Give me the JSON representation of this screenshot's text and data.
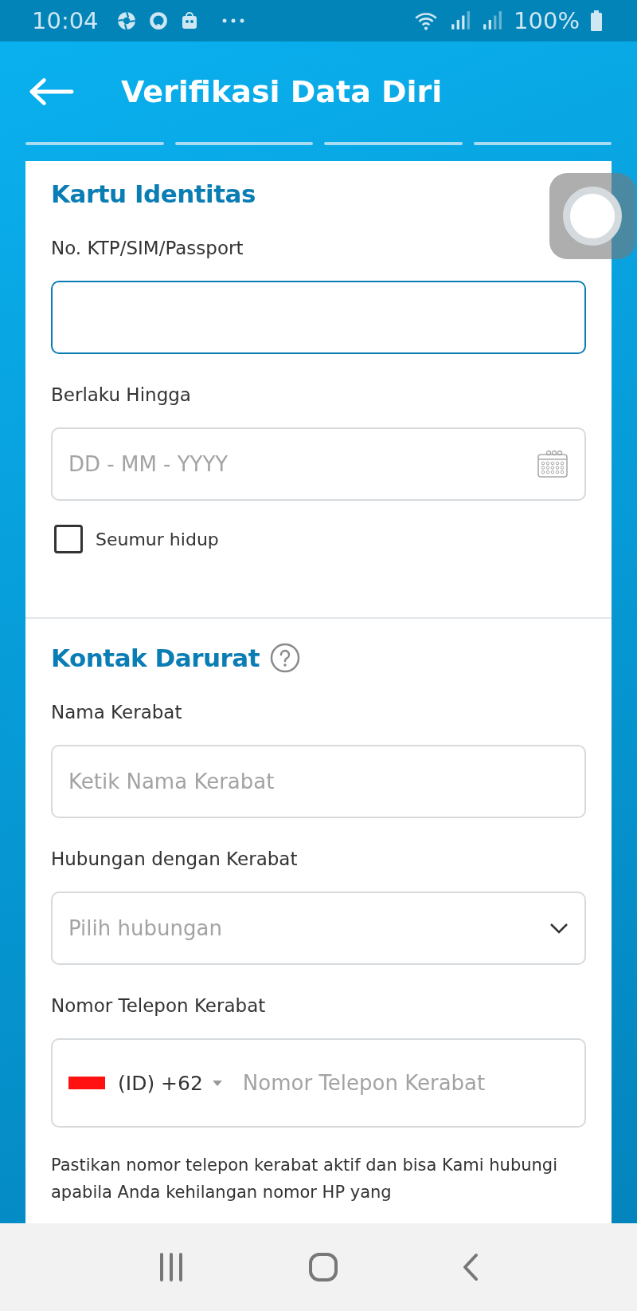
{
  "status_bar": {
    "time": "10:04",
    "battery": "100%"
  },
  "header": {
    "title": "Verifikasi Data Diri"
  },
  "sections": [
    {
      "title": "Kartu Identitas",
      "help": false,
      "items": [
        {
          "kind": "text",
          "label": "No. KTP/SIM/Passport",
          "focused": true
        },
        {
          "kind": "date",
          "label": "Berlaku Hingga",
          "placeholder": "DD - MM - YYYY",
          "focused": false
        },
        {
          "kind": "checkbox",
          "label": "Seumur hidup",
          "checked": false
        }
      ]
    },
    {
      "title": "Kontak Darurat",
      "help": true,
      "items": [
        {
          "kind": "text",
          "label": "Nama Kerabat",
          "placeholder": "Ketik Nama Kerabat",
          "focused": false
        },
        {
          "kind": "select",
          "label": "Hubungan dengan Kerabat",
          "placeholder": "Pilih hubungan",
          "focused": false
        },
        {
          "kind": "phone",
          "label": "Nomor Telepon Kerabat",
          "country_code": "(ID) +62",
          "placeholder": "Nomor Telepon Kerabat",
          "focused": false
        },
        {
          "kind": "note",
          "text": "Pastikan nomor telepon kerabat aktif dan bisa Kami hubungi apabila Anda kehilangan nomor HP yang"
        }
      ]
    }
  ]
}
